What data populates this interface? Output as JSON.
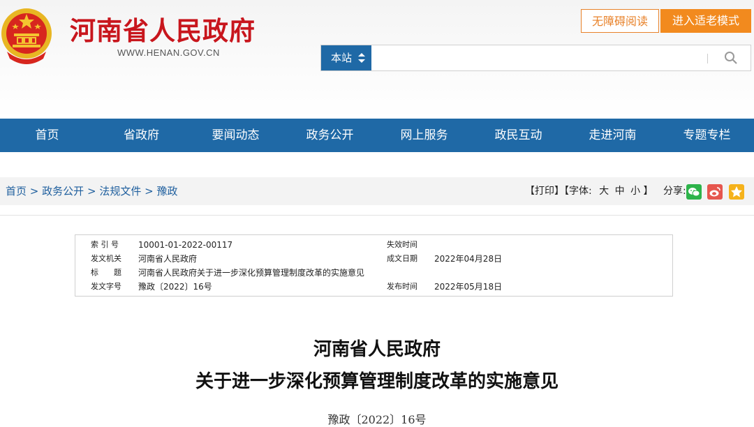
{
  "header": {
    "site_title": "河南省人民政府",
    "site_url": "WWW.HENAN.GOV.CN",
    "accessibility_label": "无障碍阅读",
    "elder_mode_label": "进入适老模式",
    "search": {
      "scope_label": "本站",
      "placeholder": ""
    }
  },
  "nav": [
    "首页",
    "省政府",
    "要闻动态",
    "政务公开",
    "网上服务",
    "政民互动",
    "走进河南",
    "专题专栏"
  ],
  "breadcrumb": {
    "items": [
      "首页",
      "政务公开",
      "法规文件",
      "豫政"
    ],
    "separator": ">"
  },
  "tools": {
    "print_label": "【打印】",
    "font_label": "【字体:",
    "font_large": "大",
    "font_medium": "中",
    "font_small": "小",
    "font_close": "】",
    "share_label": "分享:",
    "share_icons": [
      "wechat-icon",
      "weibo-icon",
      "qzone-icon"
    ]
  },
  "metadata": {
    "index_label": "索 引 号",
    "index_value": "10001-01-2022-00117",
    "expiry_label": "失效时间",
    "expiry_value": "",
    "issuer_label": "发文机关",
    "issuer_value": "河南省人民政府",
    "date_written_label": "成文日期",
    "date_written_value": "2022年04月28日",
    "subject_label": "标　　题",
    "subject_value": "河南省人民政府关于进一步深化预算管理制度改革的实施意见",
    "doc_number_label": "发文字号",
    "doc_number_value": "豫政〔2022〕16号",
    "publish_label": "发布时间",
    "publish_value": "2022年05月18日"
  },
  "document": {
    "title_line1": "河南省人民政府",
    "title_line2": "关于进一步深化预算管理制度改革的实施意见",
    "number": "豫政〔2022〕16号"
  },
  "colors": {
    "brand_red": "#c8161d",
    "nav_blue": "#1f69a6",
    "accent_orange": "#f28a1e",
    "link_blue": "#1f5f9e"
  }
}
